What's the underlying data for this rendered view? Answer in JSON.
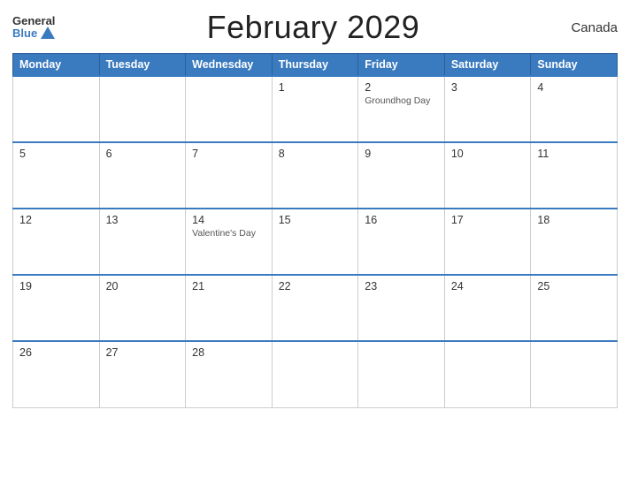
{
  "header": {
    "logo_general": "General",
    "logo_blue": "Blue",
    "title": "February 2029",
    "country": "Canada"
  },
  "calendar": {
    "days_of_week": [
      "Monday",
      "Tuesday",
      "Wednesday",
      "Thursday",
      "Friday",
      "Saturday",
      "Sunday"
    ],
    "weeks": [
      [
        {
          "day": "",
          "empty": true
        },
        {
          "day": "",
          "empty": true
        },
        {
          "day": "",
          "empty": true
        },
        {
          "day": "1",
          "event": ""
        },
        {
          "day": "2",
          "event": "Groundhog Day"
        },
        {
          "day": "3",
          "event": ""
        },
        {
          "day": "4",
          "event": ""
        }
      ],
      [
        {
          "day": "5",
          "event": ""
        },
        {
          "day": "6",
          "event": ""
        },
        {
          "day": "7",
          "event": ""
        },
        {
          "day": "8",
          "event": ""
        },
        {
          "day": "9",
          "event": ""
        },
        {
          "day": "10",
          "event": ""
        },
        {
          "day": "11",
          "event": ""
        }
      ],
      [
        {
          "day": "12",
          "event": ""
        },
        {
          "day": "13",
          "event": ""
        },
        {
          "day": "14",
          "event": "Valentine's Day"
        },
        {
          "day": "15",
          "event": ""
        },
        {
          "day": "16",
          "event": ""
        },
        {
          "day": "17",
          "event": ""
        },
        {
          "day": "18",
          "event": ""
        }
      ],
      [
        {
          "day": "19",
          "event": ""
        },
        {
          "day": "20",
          "event": ""
        },
        {
          "day": "21",
          "event": ""
        },
        {
          "day": "22",
          "event": ""
        },
        {
          "day": "23",
          "event": ""
        },
        {
          "day": "24",
          "event": ""
        },
        {
          "day": "25",
          "event": ""
        }
      ],
      [
        {
          "day": "26",
          "event": ""
        },
        {
          "day": "27",
          "event": ""
        },
        {
          "day": "28",
          "event": ""
        },
        {
          "day": "",
          "empty": true
        },
        {
          "day": "",
          "empty": true
        },
        {
          "day": "",
          "empty": true
        },
        {
          "day": "",
          "empty": true
        }
      ]
    ]
  }
}
